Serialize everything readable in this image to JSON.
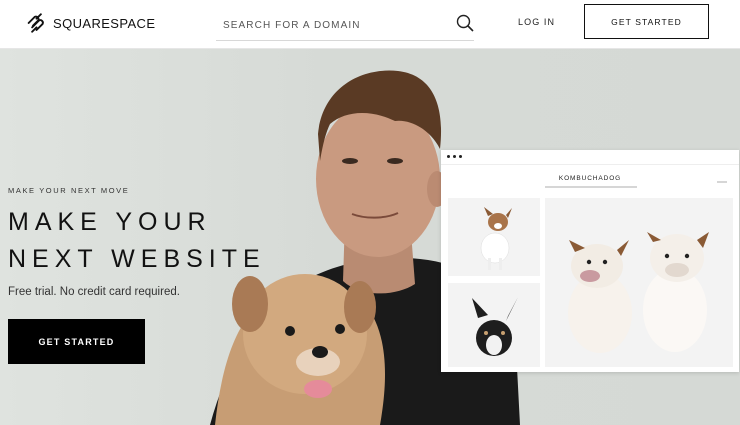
{
  "header": {
    "brand": "SQUARESPACE",
    "search_placeholder": "SEARCH FOR A DOMAIN",
    "login_label": "LOG IN",
    "cta_label": "GET STARTED"
  },
  "hero": {
    "eyebrow": "MAKE YOUR NEXT MOVE",
    "headline_line1": "MAKE YOUR",
    "headline_line2": "NEXT WEBSITE",
    "tagline": "Free trial. No credit card required.",
    "cta_label": "GET STARTED"
  },
  "preview": {
    "site_name": "KOMBUCHADOG"
  }
}
